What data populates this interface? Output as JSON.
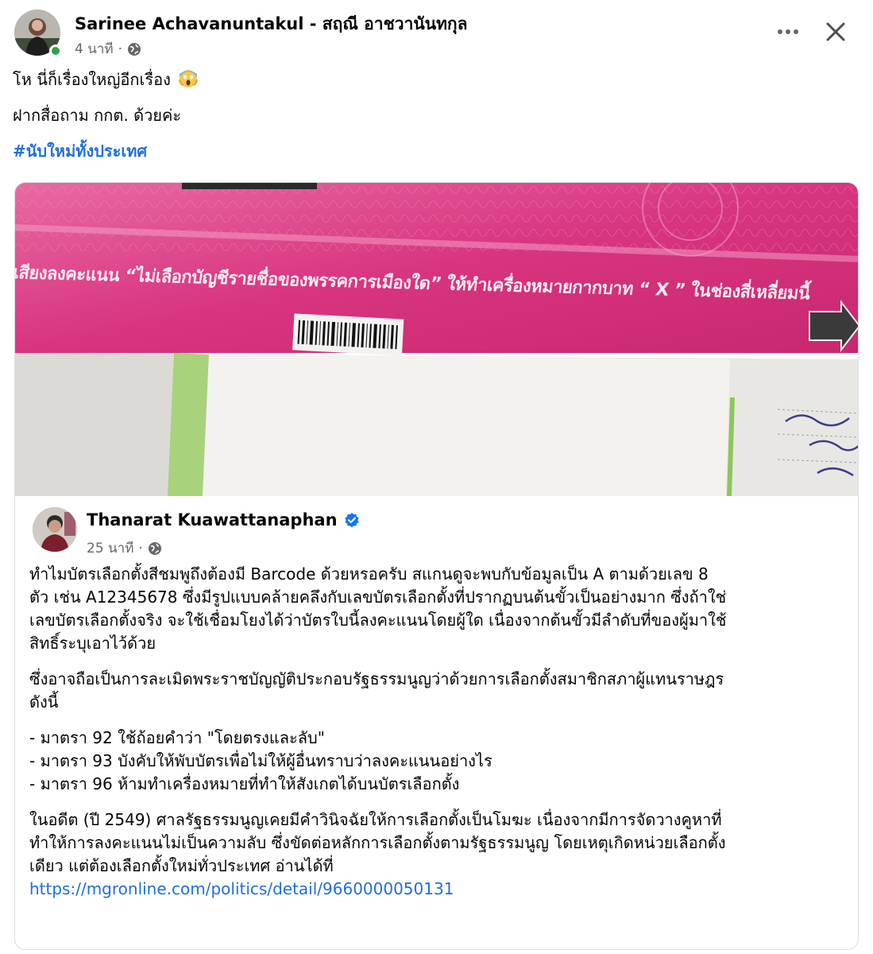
{
  "post": {
    "author": "Sarinee Achavanuntakul - สฤณี อาชวานันทกุล",
    "time": "4 นาที",
    "dot": "·",
    "privacy_icon": "globe-icon",
    "lines": [
      "โห นี่ก็เรื่องใหญ่อีกเรื่อง",
      "ฝากสื่อถาม กกต. ด้วยค่ะ"
    ],
    "emoji": "face-screaming-in-fear",
    "hashtag": "#นับใหม่ทั้งประเทศ"
  },
  "photo": {
    "ballot_text": "เสียงลงคะแนน “ไม่เลือกบัญชีรายชื่อของพรรคการเมืองใด” ให้ทำเครื่องหมายกากบาท “ X ” ในช่องสี่เหลี่ยมนี้",
    "ballot_color": "#d8347f"
  },
  "shared": {
    "author": "Thanarat Kuawattanaphan",
    "verified_icon": "verified-badge-icon",
    "time": "25 นาที",
    "dot": "·",
    "para1": [
      "ทำไมบัตรเลือกตั้งสีชมพูถึงต้องมี Barcode ด้วยหรอครับ สแกนดูจะพบกับข้อมูลเป็น A ตามด้วยเลข 8",
      "ตัว เช่น A12345678 ซึ่งมีรูปแบบคล้ายคลึงกับเลขบัตรเลือกตั้งที่ปรากฏบนต้นขั้วเป็นอย่างมาก ซึ่งถ้าใช่",
      "เลขบัตรเลือกตั้งจริง จะใช้เชื่อมโยงได้ว่าบัตรใบนี้ลงคะแนนโดยผู้ใด เนื่องจากต้นขั้วมีลำดับที่ของผู้มาใช้",
      "สิทธิ์ระบุเอาไว้ด้วย"
    ],
    "para2": [
      "ซึ่งอาจถือเป็นการละเมิดพระราชบัญญัติประกอบรัฐธรรมนูญว่าด้วยการเลือกตั้งสมาชิกสภาผู้แทนราษฎร",
      "ดังนี้"
    ],
    "bullets": [
      "- มาตรา 92 ใช้ถ้อยคำว่า \"โดยตรงและลับ\"",
      "- มาตรา 93 บังคับให้พับบัตรเพื่อไม่ให้ผู้อื่นทราบว่าลงคะแนนอย่างไร",
      "- มาตรา 96 ห้ามทำเครื่องหมายที่ทำให้สังเกตได้บนบัตรเลือกตั้ง"
    ],
    "para4": [
      "ในอดีต (ปี 2549) ศาลรัฐธรรมนูญเคยมีคำวินิจฉัยให้การเลือกตั้งเป็นโมฆะ เนื่องจากมีการจัดวางคูหาที่",
      "ทำให้การลงคะแนนไม่เป็นความลับ ซึ่งขัดต่อหลักการเลือกตั้งตามรัฐธรรมนูญ โดยเหตุเกิดหน่วยเลือกตั้ง",
      "เดียว แต่ต้องเลือกตั้งใหม่ทั่วประเทศ อ่านได้ที่"
    ],
    "link": "https://mgronline.com/politics/detail/9660000050131"
  },
  "colors": {
    "link": "#216fdb",
    "meta": "#65676b",
    "online": "#31a24c",
    "verified": "#1877f2"
  }
}
